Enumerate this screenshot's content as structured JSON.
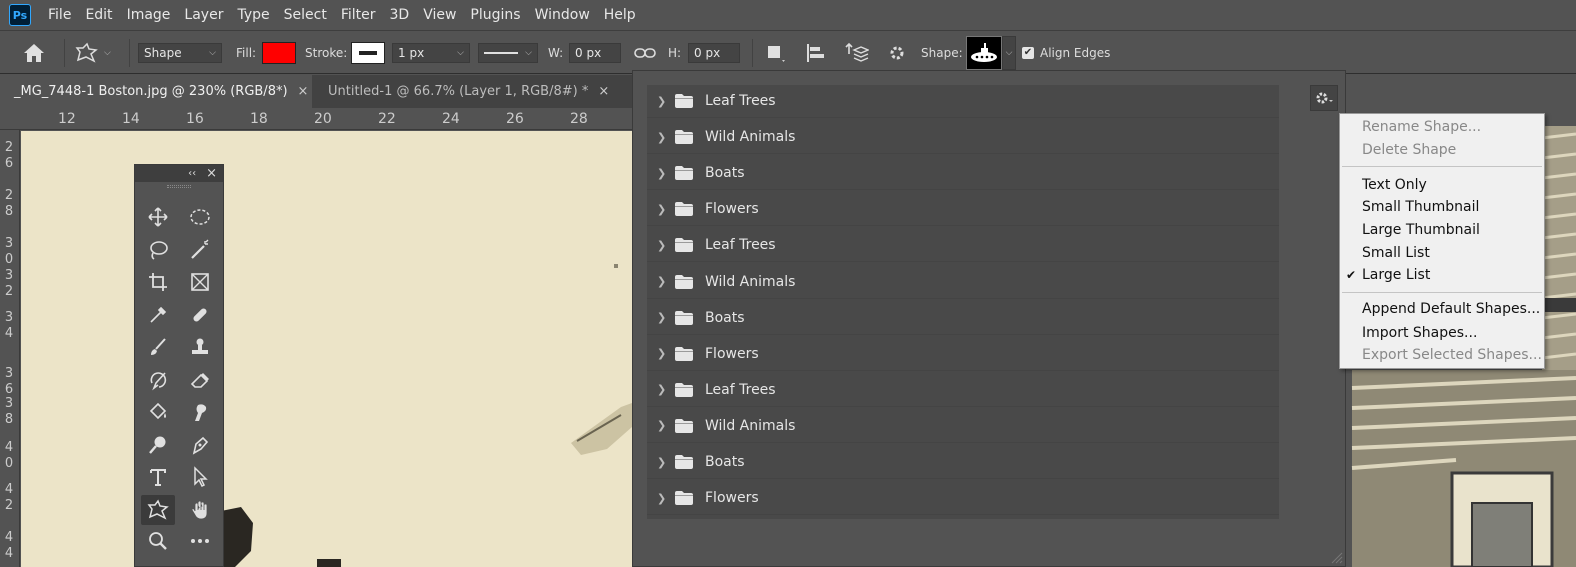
{
  "app": {
    "logo": "Ps"
  },
  "menu": [
    "File",
    "Edit",
    "Image",
    "Layer",
    "Type",
    "Select",
    "Filter",
    "3D",
    "View",
    "Plugins",
    "Window",
    "Help"
  ],
  "options": {
    "mode": "Shape",
    "fill_label": "Fill:",
    "fill_color": "#ff0000",
    "stroke_label": "Stroke:",
    "stroke_width": "1 px",
    "w_label": "W:",
    "w_value": "0 px",
    "h_label": "H:",
    "h_value": "0 px",
    "shape_label": "Shape:",
    "align_edges": "Align Edges",
    "align_edges_checked": true
  },
  "tabs": [
    {
      "label": "_MG_7448-1 Boston.jpg @ 230% (RGB/8*)",
      "close": "×",
      "active": true
    },
    {
      "label": "Untitled-1 @ 66.7% (Layer 1, RGB/8#) *",
      "close": "×",
      "active": false
    }
  ],
  "ruler": {
    "top": [
      "12",
      "14",
      "16",
      "18",
      "20",
      "22",
      "24",
      "26",
      "28"
    ],
    "left": [
      "2\n6",
      "2\n8",
      "3\n0",
      "3\n2",
      "3\n4",
      "3\n6",
      "3\n8",
      "4\n0",
      "4\n2",
      "4\n4"
    ]
  },
  "toolbox": {
    "collapse": "‹‹",
    "close": "×"
  },
  "shape_groups": [
    "Leaf Trees",
    "Wild Animals",
    "Boats",
    "Flowers",
    "Leaf Trees",
    "Wild Animals",
    "Boats",
    "Flowers",
    "Leaf Trees",
    "Wild Animals",
    "Boats",
    "Flowers"
  ],
  "flyout": {
    "rename": "Rename Shape...",
    "delete": "Delete Shape",
    "text_only": "Text Only",
    "small_thumb": "Small Thumbnail",
    "large_thumb": "Large Thumbnail",
    "small_list": "Small List",
    "large_list": "Large List",
    "check": "✔",
    "append": "Append Default Shapes...",
    "import": "Import Shapes...",
    "export": "Export Selected Shapes..."
  },
  "colors": {
    "accent": "#31a8ff",
    "panel": "#535353",
    "canvas": "#ece4c8"
  }
}
